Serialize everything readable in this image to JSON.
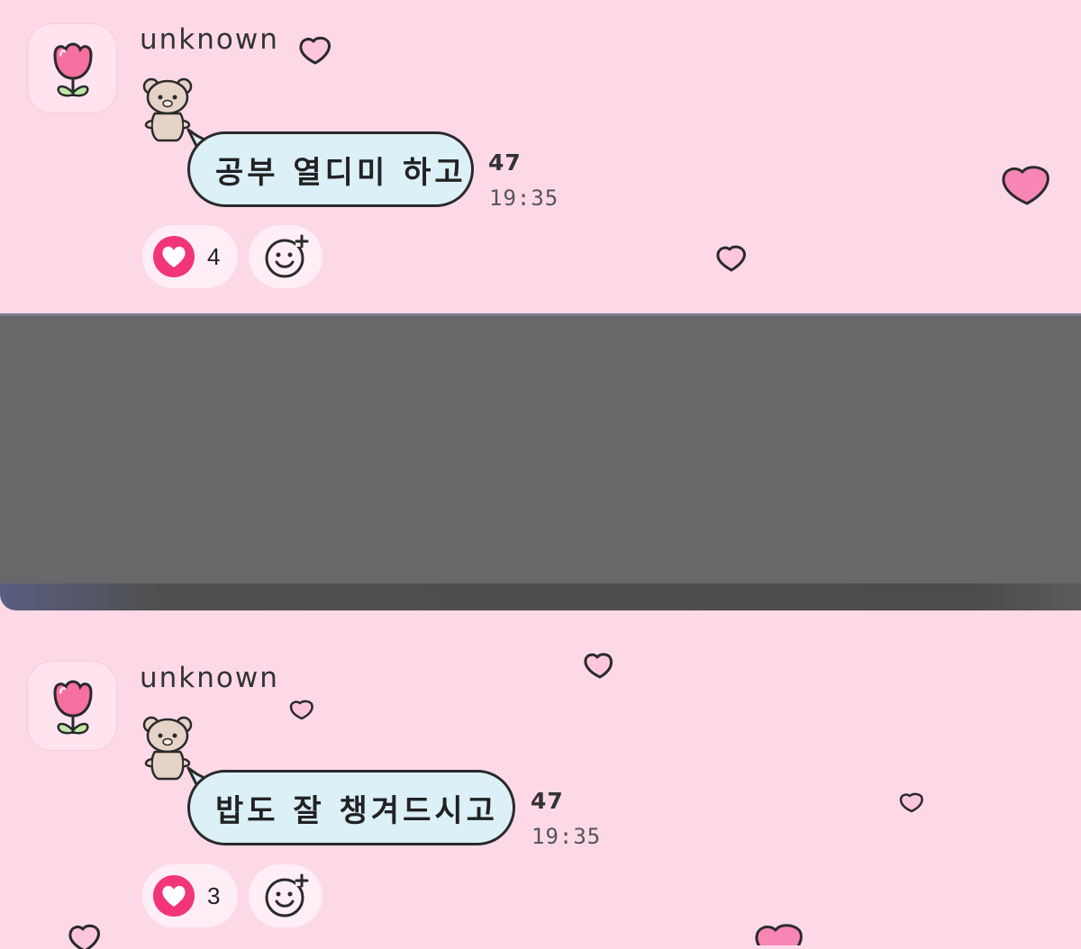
{
  "messages": [
    {
      "sender": "unknown",
      "text": "공부 열디미 하고",
      "read_count": "47",
      "time": "19:35",
      "reaction_count": "4"
    },
    {
      "sender": "unknown",
      "text": "밥도 잘 챙겨드시고",
      "read_count": "47",
      "time": "19:35",
      "reaction_count": "3"
    }
  ],
  "icons": {
    "avatar": "tulip-icon",
    "sticker": "bear-icon",
    "reaction": "heart-icon",
    "add_reaction": "smiley-plus-icon",
    "decoration": "heart-icon"
  },
  "colors": {
    "background": "#fdd9e7",
    "bubble": "#dcf0f8",
    "heart_accent": "#f2347a",
    "tulip": "#f56fa0",
    "redaction": "#68686b"
  }
}
